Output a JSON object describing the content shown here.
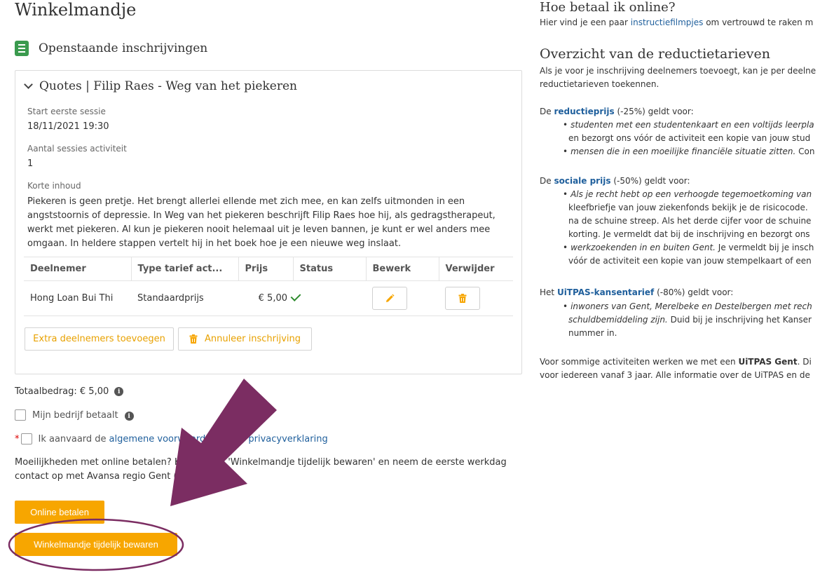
{
  "page_title": "Winkelmandje",
  "section_title": "Openstaande inschrijvingen",
  "card": {
    "title": "Quotes | Filip Raes - Weg van het piekeren",
    "fields": [
      {
        "label": "Start eerste sessie",
        "value": "18/11/2021 19:30"
      },
      {
        "label": "Aantal sessies activiteit",
        "value": "1"
      }
    ],
    "desc_label": "Korte inhoud",
    "description": "Piekeren is geen pretje. Het brengt allerlei ellende met zich mee, en kan zelfs uitmonden in een angststoornis of depressie. In Weg van het piekeren beschrijft Filip Raes hoe hij, als gedragstherapeut, werkt met piekeren. Al kun je piekeren nooit helemaal uit je leven bannen, je kunt er wel anders mee omgaan. In heldere stappen vertelt hij in het boek hoe je een nieuwe weg inslaat.",
    "table": {
      "headers": [
        "Deelnemer",
        "Type tarief act...",
        "Prijs",
        "Status",
        "Bewerk",
        "Verwijder"
      ],
      "rows": [
        {
          "deelnemer": "Hong Loan Bui Thi",
          "tarief": "Standaardprijs",
          "prijs": "€ 5,00"
        }
      ]
    },
    "add_button": "Extra deelnemers toevoegen",
    "cancel_button": "Annuleer inschrijving"
  },
  "total": "Totaalbedrag: € 5,00",
  "company_pays": "Mijn bedrijf betaalt",
  "terms": {
    "asterisk": "*",
    "prefix": "Ik aanvaard de",
    "link": "algemene voorwaarden en de privacyverklaring"
  },
  "help_text": "Moeilijkheden met online betalen? Klik dan op 'Winkelmandje tijdelijk bewaren' en neem de eerste werkdag contact op met Avansa regio Gent (09",
  "pay_button": "Online betalen",
  "save_button": "Winkelmandje tijdelijk bewaren",
  "right": {
    "h1": "Hoe betaal ik online?",
    "p1_prefix": "Hier vind je een paar",
    "p1_link": "instructiefilmpjes",
    "p1_suffix": "om vertrouwd te raken m",
    "h2": "Overzicht van de reductietarieven",
    "p2_line1": "Als je voor je inschrijving deelnemers toevoegt, kan je per deelne",
    "p2_line2": "reductietarieven toekennen.",
    "r1_prefix": "De",
    "r1_bold": "reductieprijs",
    "r1_suffix": "(-25%) geldt voor:",
    "r1_items": [
      "studenten met een studentenkaart en een voltijds leerpla",
      "en bezorgt ons vóór de activiteit een kopie van jouw stud",
      "mensen die in een moeilijke financiële situatie zitten.",
      "Con"
    ],
    "r2_prefix": "De",
    "r2_bold": "sociale prijs",
    "r2_suffix": "(-50%) geldt voor:",
    "r2_items": [
      "Als je recht hebt op een verhoogde tegemoetkoming van",
      "kleefbriefje van jouw ziekenfonds bekijk je de risicocode.",
      "na de schuine streep. Als het derde cijfer voor de schuine",
      "korting. Je vermeldt dat bij de inschrijving en bezorgt ons",
      "werkzoekenden in en buiten Gent.",
      "Je vermeldt bij je insch",
      "vóór de activiteit een kopie van jouw stempelkaart of een"
    ],
    "r3_prefix": "Het",
    "r3_bold": "UiTPAS-kansentarief",
    "r3_suffix": "(-80%) geldt voor:",
    "r3_items": [
      "inwoners van Gent, Merelbeke en Destelbergen met rech",
      "schuldbemiddeling zijn.",
      "Duid bij je inschrijving het Kanser",
      "nummer in."
    ],
    "p3_line1_prefix": "Voor sommige activiteiten werken we met een",
    "p3_line1_bold": "UiTPAS Gent",
    "p3_line1_suffix": ". Di",
    "p3_line2": "voor iedereen vanaf 3 jaar. Alle informatie over de UiTPAS en de"
  },
  "colors": {
    "accent": "#f7a600",
    "annotation": "#7b2d62",
    "link": "#1f5f9c",
    "success": "#2e8b2e"
  }
}
